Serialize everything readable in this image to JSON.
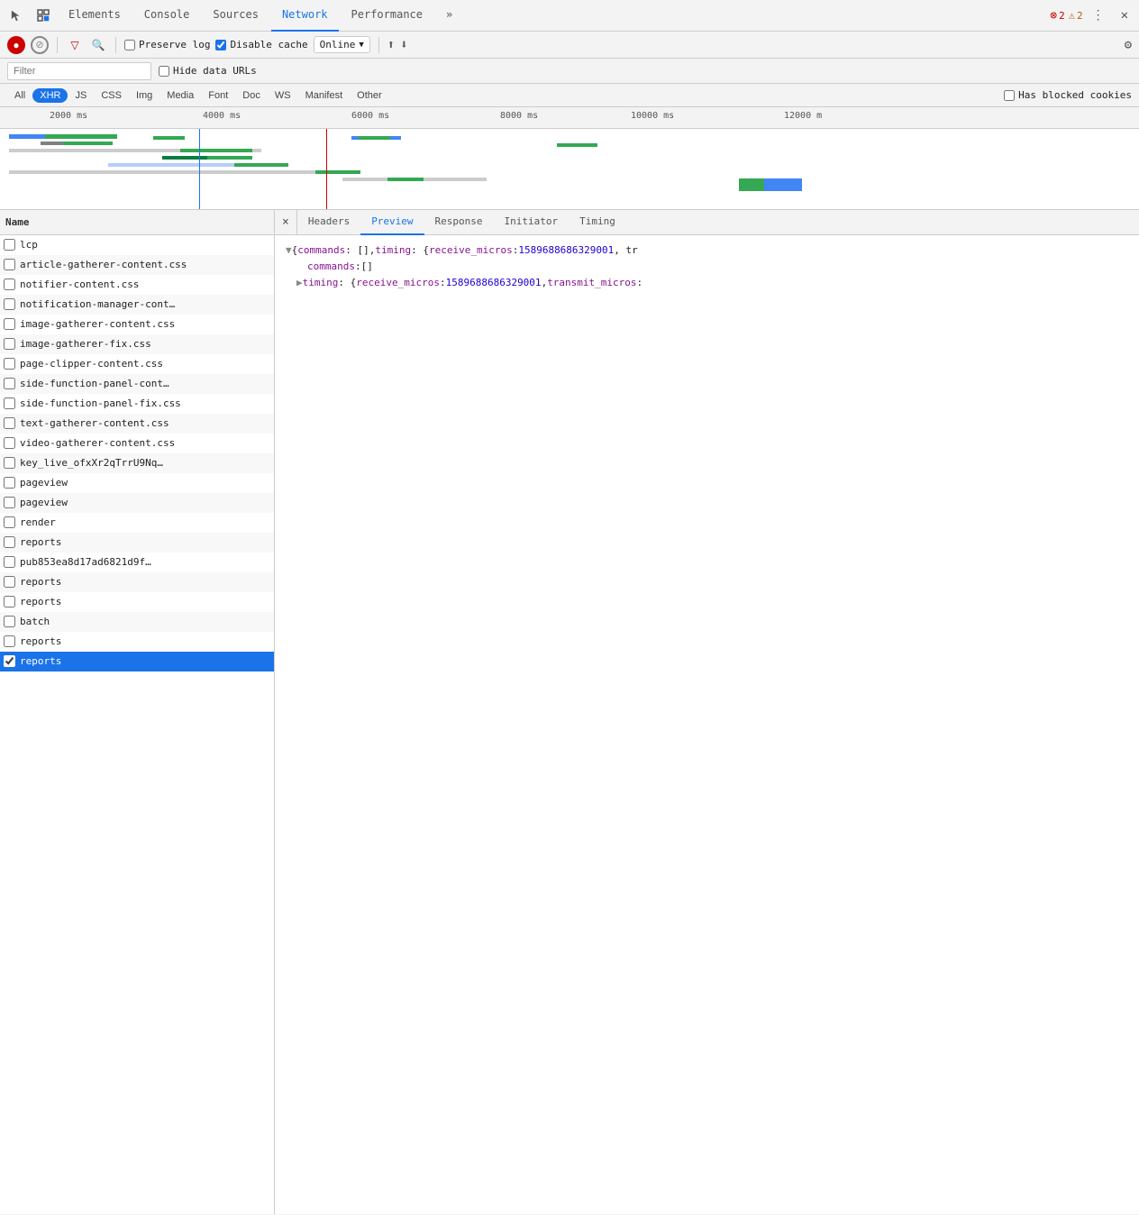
{
  "tabs": {
    "items": [
      {
        "label": "Elements",
        "active": false
      },
      {
        "label": "Console",
        "active": false
      },
      {
        "label": "Sources",
        "active": false
      },
      {
        "label": "Network",
        "active": true
      },
      {
        "label": "Performance",
        "active": false
      },
      {
        "label": "»",
        "active": false
      }
    ]
  },
  "toolbar": {
    "preserve_log": "Preserve log",
    "disable_cache": "Disable cache",
    "online_label": "Online",
    "upload_icon": "⬆",
    "download_icon": "⬇",
    "settings_icon": "⚙"
  },
  "filter_bar": {
    "placeholder": "Filter",
    "hide_urls": "Hide data URLs"
  },
  "type_bar": {
    "types": [
      "All",
      "XHR",
      "JS",
      "CSS",
      "Img",
      "Media",
      "Font",
      "Doc",
      "WS",
      "Manifest",
      "Other"
    ],
    "active": "XHR",
    "has_blocked": "Has blocked cookies"
  },
  "waterfall": {
    "labels": [
      "2000 ms",
      "4000 ms",
      "6000 ms",
      "8000 ms",
      "10000 ms",
      "12000 m"
    ]
  },
  "file_list": {
    "header": "Name",
    "items": [
      {
        "name": "lcp",
        "alt": false,
        "selected": false
      },
      {
        "name": "article-gatherer-content.css",
        "alt": true,
        "selected": false
      },
      {
        "name": "notifier-content.css",
        "alt": false,
        "selected": false
      },
      {
        "name": "notification-manager-cont…",
        "alt": true,
        "selected": false
      },
      {
        "name": "image-gatherer-content.css",
        "alt": false,
        "selected": false
      },
      {
        "name": "image-gatherer-fix.css",
        "alt": true,
        "selected": false
      },
      {
        "name": "page-clipper-content.css",
        "alt": false,
        "selected": false
      },
      {
        "name": "side-function-panel-cont…",
        "alt": true,
        "selected": false
      },
      {
        "name": "side-function-panel-fix.css",
        "alt": false,
        "selected": false
      },
      {
        "name": "text-gatherer-content.css",
        "alt": true,
        "selected": false
      },
      {
        "name": "video-gatherer-content.css",
        "alt": false,
        "selected": false
      },
      {
        "name": "key_live_ofxXr2qTrrU9Nq…",
        "alt": true,
        "selected": false
      },
      {
        "name": "pageview",
        "alt": false,
        "selected": false
      },
      {
        "name": "pageview",
        "alt": true,
        "selected": false
      },
      {
        "name": "render",
        "alt": false,
        "selected": false
      },
      {
        "name": "reports",
        "alt": true,
        "selected": false
      },
      {
        "name": "pub853ea8d17ad6821d9f…",
        "alt": false,
        "selected": false
      },
      {
        "name": "reports",
        "alt": true,
        "selected": false
      },
      {
        "name": "reports",
        "alt": false,
        "selected": false
      },
      {
        "name": "batch",
        "alt": true,
        "selected": false
      },
      {
        "name": "reports",
        "alt": false,
        "selected": false
      },
      {
        "name": "reports",
        "alt": false,
        "selected": true
      }
    ]
  },
  "detail": {
    "tabs": [
      "×",
      "Headers",
      "Preview",
      "Response",
      "Initiator",
      "Timing"
    ],
    "active_tab": "Preview",
    "preview": {
      "line1_prefix": "▼ ",
      "line1": "{commands: [], timing: {receive_micros: 1589688686329001, tr",
      "line2_indent": "    ",
      "line2_key": "commands",
      "line2_colon": ":",
      "line2_value": " []",
      "line3_prefix": "  ▶ ",
      "line3_key": "timing",
      "line3_colon": ":",
      "line3_value": " {receive_micros: 1589688686329001, transmit_micros:"
    }
  },
  "errors": {
    "error_count": "2",
    "warn_count": "2"
  }
}
